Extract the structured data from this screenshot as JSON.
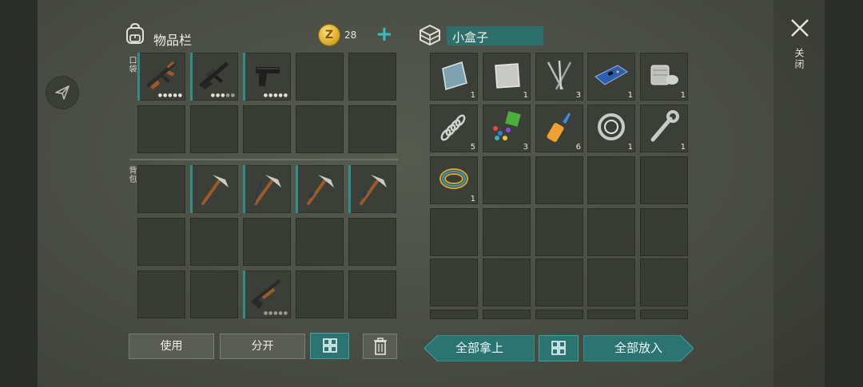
{
  "inventory": {
    "title": "物品栏",
    "coins": "28",
    "pocket_label": "口袋",
    "backpack_label": "背包",
    "pocket_durability": [
      "5",
      "3",
      "5"
    ]
  },
  "container": {
    "title": "小盒子",
    "quantities": [
      "1",
      "1",
      "3",
      "1",
      "1",
      "5",
      "3",
      "6",
      "1",
      "1",
      "1"
    ]
  },
  "buttons": {
    "use": "使用",
    "split": "分开",
    "take_all": "全部拿上",
    "put_all": "全部放入"
  },
  "close": {
    "label": "关闭"
  },
  "icons": [
    "backpack-icon",
    "coin-icon",
    "plus-icon",
    "box-icon",
    "compass-icon",
    "grid-icon",
    "trash-icon",
    "close-icon"
  ],
  "colors": {
    "accent": "#2f8e8a",
    "teal_button": "#2c7472",
    "coin": "#d8a21f"
  }
}
